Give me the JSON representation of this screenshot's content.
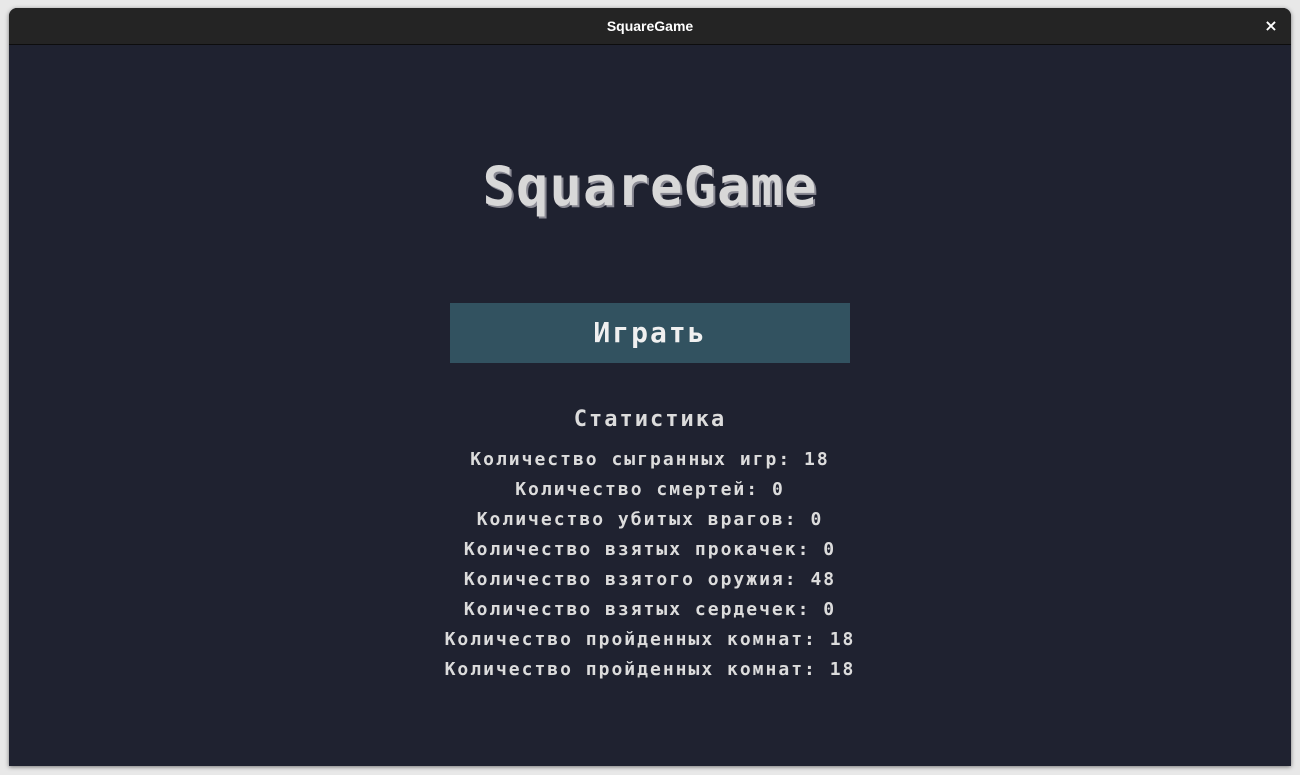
{
  "window": {
    "title": "SquareGame",
    "close_glyph": "×"
  },
  "game": {
    "title": "SquareGame",
    "play_label": "Играть"
  },
  "stats": {
    "heading": "Статистика",
    "items": [
      {
        "label": "Количество сыгранных игр:",
        "value": "18"
      },
      {
        "label": "Количество смертей:",
        "value": "0"
      },
      {
        "label": "Количество убитых врагов:",
        "value": "0"
      },
      {
        "label": "Количество взятых прокачек:",
        "value": "0"
      },
      {
        "label": "Количество взятого оружия:",
        "value": "48"
      },
      {
        "label": "Количество взятых сердечек:",
        "value": "0"
      },
      {
        "label": "Количество пройденных комнат:",
        "value": "18"
      },
      {
        "label": "Количество пройденных комнат:",
        "value": "18"
      }
    ]
  },
  "colors": {
    "background": "#1f2230",
    "button": "#325260",
    "text": "#dcdcdc",
    "titlebar": "#242424"
  }
}
